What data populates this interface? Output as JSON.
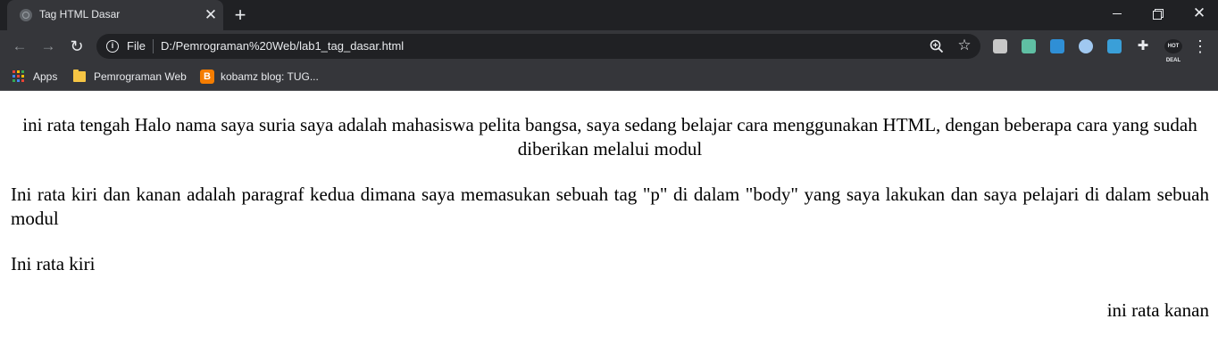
{
  "browser": {
    "tab": {
      "title": "Tag HTML Dasar",
      "close_glyph": "✕"
    },
    "new_tab_glyph": "+",
    "window_controls": {
      "close_glyph": "✕"
    },
    "toolbar": {
      "back_glyph": "←",
      "forward_glyph": "→",
      "reload_glyph": "↻",
      "info_glyph": "i",
      "scheme_label": "File",
      "url": "D:/Pemrograman%20Web/lab1_tag_dasar.html",
      "star_glyph": "☆",
      "puzzle_glyph": "✚",
      "hot_deals_label": "HOT DEAL",
      "menu_glyph": "⋮"
    },
    "bookmarks": [
      {
        "label": "Apps",
        "icon": "apps-grid-icon"
      },
      {
        "label": "Pemrograman Web",
        "icon": "folder-icon"
      },
      {
        "label": "kobamz blog: TUG...",
        "icon": "blogger-icon",
        "icon_glyph": "B"
      }
    ]
  },
  "page": {
    "paragraphs": [
      {
        "text": "ini rata tengah Halo nama saya suria saya adalah mahasiswa pelita bangsa, saya sedang belajar cara menggunakan HTML, dengan beberapa cara yang sudah diberikan melalui modul",
        "align": "center"
      },
      {
        "text": "Ini rata kiri dan kanan adalah paragraf kedua dimana saya memasukan sebuah tag \"p\" di dalam \"body\" yang saya lakukan dan saya pelajari di dalam sebuah modul",
        "align": "justify"
      },
      {
        "text": "Ini rata kiri",
        "align": "left"
      },
      {
        "text": "ini rata kanan",
        "align": "right"
      }
    ]
  },
  "colors": {
    "titlebar": "#202124",
    "toolbar": "#35363a",
    "text_light": "#e8eaed",
    "page_background": "#ffffff"
  }
}
